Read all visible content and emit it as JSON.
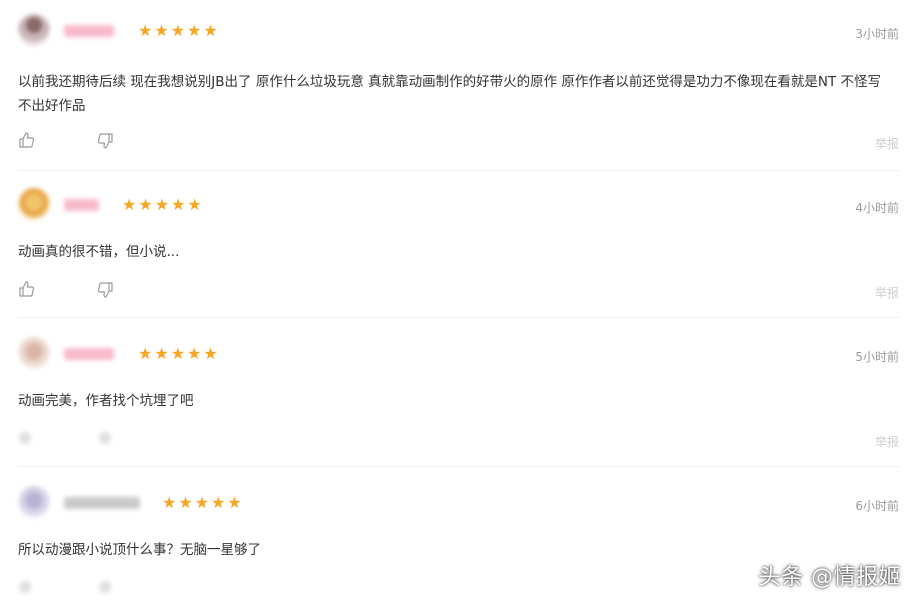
{
  "colors": {
    "star": "#f5a623",
    "time": "#9b9b9b",
    "text": "#333333",
    "report": "#cfcfcf",
    "divider": "#efefef"
  },
  "comments": [
    {
      "rating": 5,
      "time": "3小时前",
      "text": "以前我还期待后续 现在我想说别JB出了 原作什么垃圾玩意 真就靠动画制作的好带火的原作 原作作者以前还觉得是功力不像现在看就是NT 不怪写不出好作品",
      "report": "举报"
    },
    {
      "rating": 5,
      "time": "4小时前",
      "text": "动画真的很不错，但小说...",
      "report": "举报"
    },
    {
      "rating": 5,
      "time": "5小时前",
      "text": "动画完美，作者找个坑埋了吧",
      "report": "举报"
    },
    {
      "rating": 5,
      "time": "6小时前",
      "text": "所以动漫跟小说顶什么事？无脑一星够了",
      "report": ""
    }
  ],
  "watermark": "头条 @情报姬",
  "icons": {
    "like": "thumbs-up-icon",
    "dislike": "thumbs-down-icon",
    "star": "star-icon"
  }
}
